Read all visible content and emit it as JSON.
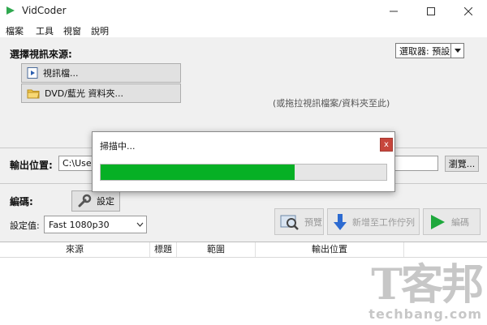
{
  "app": {
    "title": "VidCoder"
  },
  "menu": [
    "檔案",
    "工具",
    "視窗",
    "說明"
  ],
  "source": {
    "label": "選擇視訊來源:",
    "video_file": "視訊檔...",
    "dvd_folder": "DVD/藍光 資料夾...",
    "drag_hint": "(或拖拉視訊檔案/資料夾至此)"
  },
  "selector": {
    "label": "選取器: 預設"
  },
  "output": {
    "label": "輸出位置:",
    "path": "C:\\User",
    "browse": "瀏覽..."
  },
  "encoding": {
    "label": "編碼:",
    "settings_button": "設定",
    "preset_label": "設定值:",
    "preset_value": "Fast 1080p30",
    "preview": "預覽",
    "add_queue": "新增至工作佇列",
    "encode": "編碼"
  },
  "table": {
    "headers": [
      "來源",
      "標題",
      "範圍",
      "輸出位置"
    ]
  },
  "dialog": {
    "title": "掃描中...",
    "close": "x",
    "progress": 0.68
  },
  "colors": {
    "progress": "#06b025",
    "play": "#1ea83c",
    "close": "#c7463c"
  },
  "watermark": {
    "logo": "T客邦",
    "text": "techbang.com"
  }
}
